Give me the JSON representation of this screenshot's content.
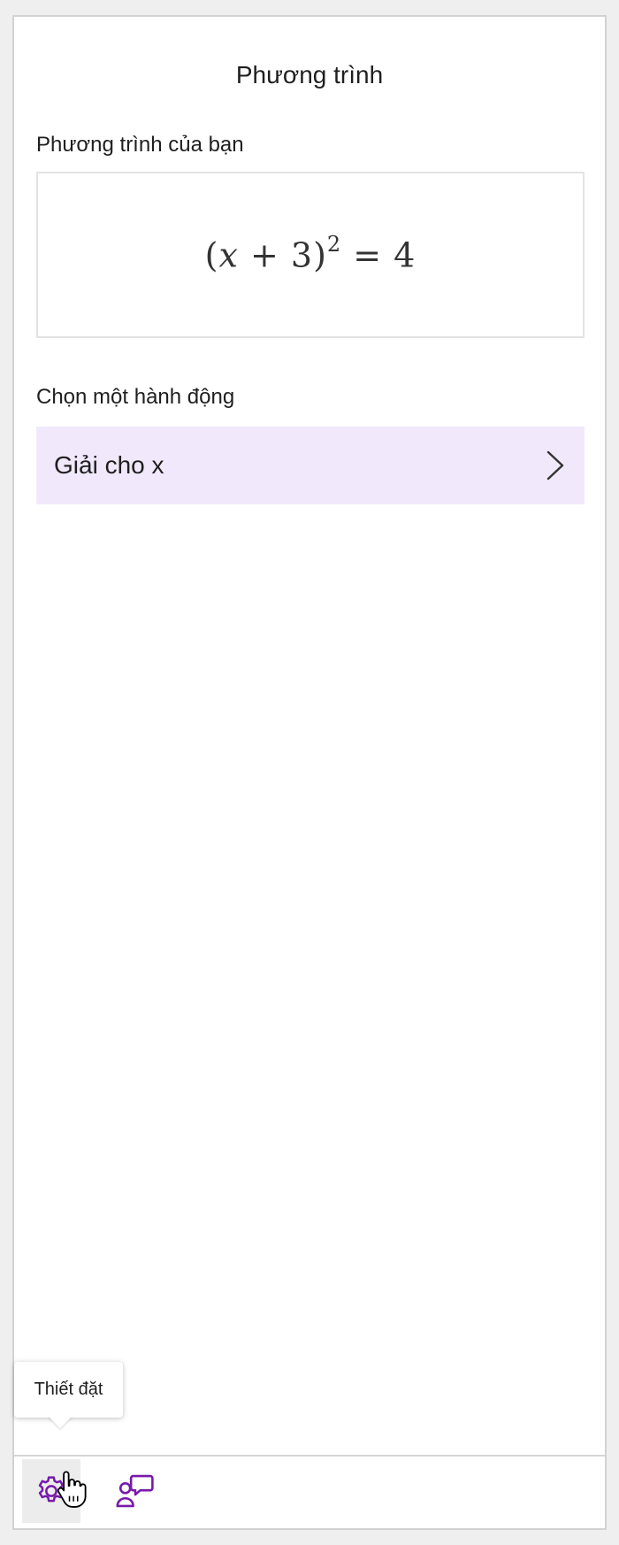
{
  "panel": {
    "title": "Phương trình",
    "your_equation_label": "Phương trình của bạn",
    "equation": {
      "open_paren": "(",
      "variable": "x",
      "plus": " + 3)",
      "exponent": "2",
      "rhs": " = 4"
    },
    "choose_action_label": "Chọn một hành động",
    "actions": [
      {
        "label": "Giải cho x",
        "icon": "chevron-right-icon"
      }
    ]
  },
  "footer": {
    "tooltip": "Thiết đặt",
    "buttons": [
      {
        "name": "settings",
        "icon": "gear-icon",
        "active": true
      },
      {
        "name": "feedback",
        "icon": "person-feedback-icon",
        "active": false
      }
    ]
  },
  "colors": {
    "accent": "#7719aa",
    "action_background": "#f1e9fb",
    "panel_border": "#d2d2d2"
  }
}
